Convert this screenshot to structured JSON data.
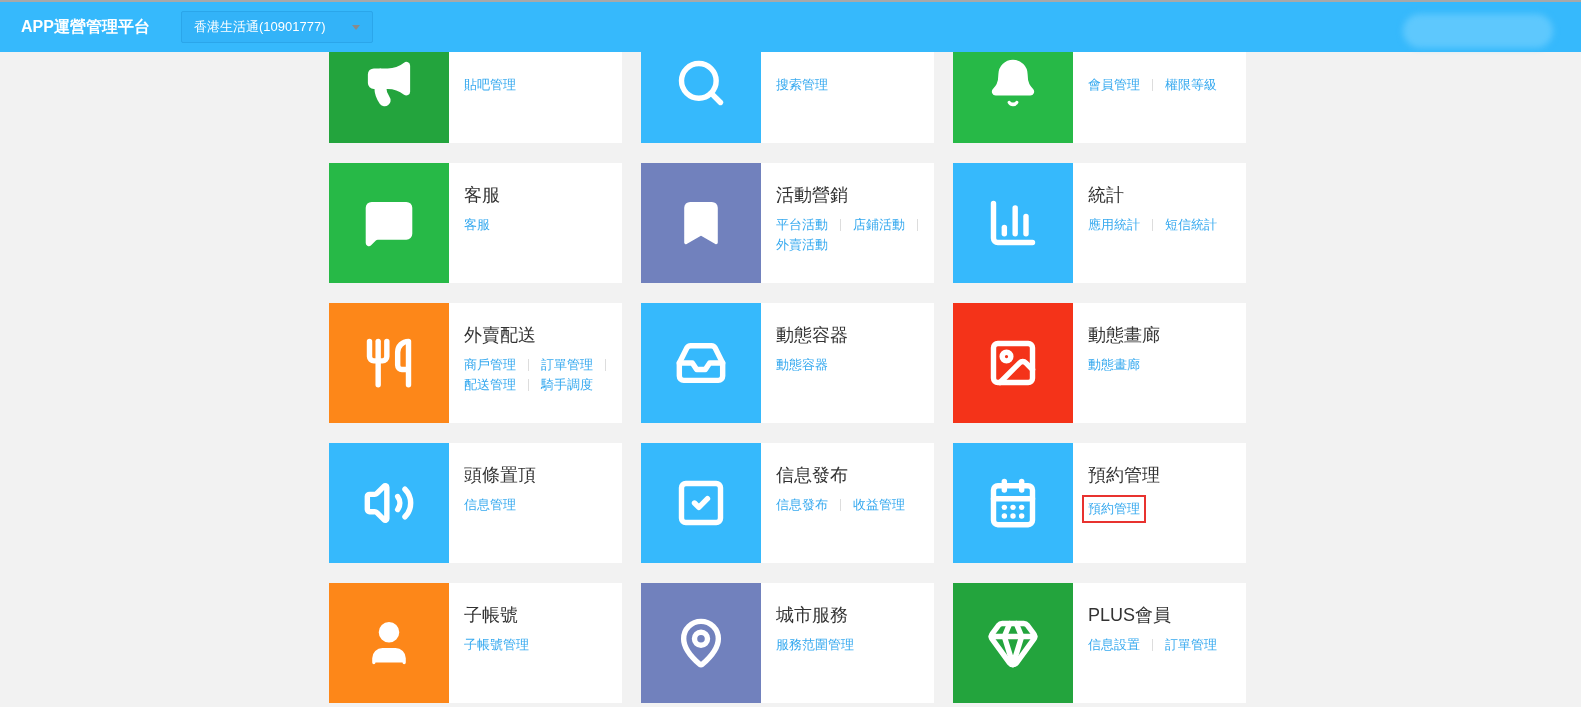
{
  "header": {
    "title": "APP運營管理平台",
    "store_select": {
      "value": "香港生活通(10901777)"
    }
  },
  "cards": [
    {
      "color": "#23a43d",
      "links": [
        {
          "label": "貼吧管理",
          "highlighted": false
        }
      ]
    },
    {
      "color": "#36b9fc",
      "links": [
        {
          "label": "搜索管理",
          "highlighted": false
        }
      ]
    },
    {
      "color": "#27b947",
      "links": [
        {
          "label": "會員管理",
          "highlighted": false
        },
        {
          "label": "權限等級",
          "highlighted": false
        }
      ]
    },
    {
      "title": "客服",
      "color": "#27b947",
      "links": [
        {
          "label": "客服",
          "highlighted": false
        }
      ]
    },
    {
      "title": "活動營銷",
      "color": "#7181bd",
      "links": [
        {
          "label": "平台活動",
          "highlighted": false
        },
        {
          "label": "店鋪活動",
          "highlighted": false
        },
        {
          "label": "外賣活動",
          "highlighted": false
        }
      ]
    },
    {
      "title": "統計",
      "color": "#36b9fc",
      "links": [
        {
          "label": "應用統計",
          "highlighted": false
        },
        {
          "label": "短信統計",
          "highlighted": false
        }
      ]
    },
    {
      "title": "外賣配送",
      "color": "#fd8719",
      "links": [
        {
          "label": "商戶管理",
          "highlighted": false
        },
        {
          "label": "訂單管理",
          "highlighted": false
        },
        {
          "label": "配送管理",
          "highlighted": false
        },
        {
          "label": "騎手調度",
          "highlighted": false
        }
      ]
    },
    {
      "title": "動態容器",
      "color": "#36b9fc",
      "links": [
        {
          "label": "動態容器",
          "highlighted": false
        }
      ]
    },
    {
      "title": "動態畫廊",
      "color": "#f43319",
      "links": [
        {
          "label": "動態畫廊",
          "highlighted": false
        }
      ]
    },
    {
      "title": "頭條置頂",
      "color": "#36b9fc",
      "links": [
        {
          "label": "信息管理",
          "highlighted": false
        }
      ]
    },
    {
      "title": "信息發布",
      "color": "#36b9fc",
      "links": [
        {
          "label": "信息發布",
          "highlighted": false
        },
        {
          "label": "收益管理",
          "highlighted": false
        }
      ]
    },
    {
      "title": "預約管理",
      "color": "#36b9fc",
      "links": [
        {
          "label": "預約管理",
          "highlighted": true
        }
      ]
    },
    {
      "title": "子帳號",
      "color": "#fd8719",
      "links": [
        {
          "label": "子帳號管理",
          "highlighted": false
        }
      ]
    },
    {
      "title": "城市服務",
      "color": "#7181bd",
      "links": [
        {
          "label": "服務范圍管理",
          "highlighted": false
        }
      ]
    },
    {
      "title": "PLUS會員",
      "color": "#23a43d",
      "links": [
        {
          "label": "信息設置",
          "highlighted": false
        },
        {
          "label": "訂單管理",
          "highlighted": false
        }
      ]
    }
  ]
}
